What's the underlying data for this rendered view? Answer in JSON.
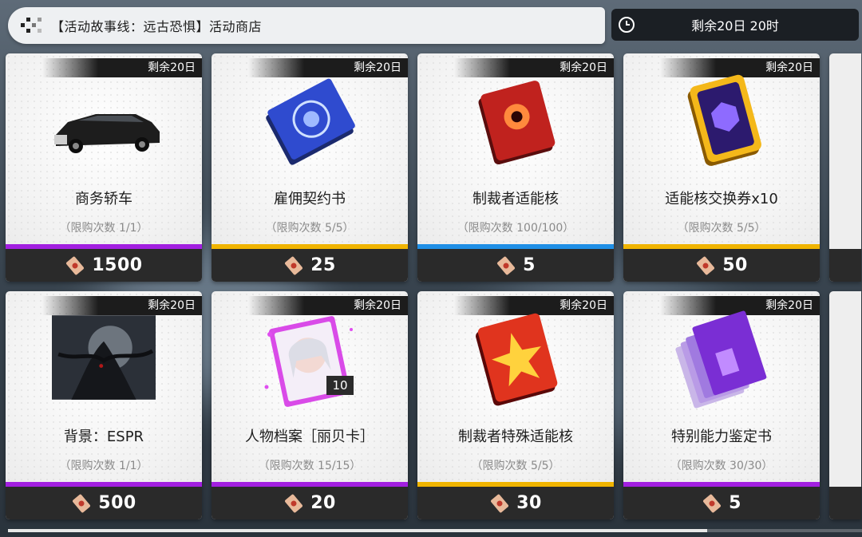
{
  "header": {
    "title": "【活动故事线：远古恐惧】活动商店",
    "timer": "剩余20日 20时"
  },
  "colors": {
    "purple": "#a21fe0",
    "gold": "#f0b400",
    "blue": "#1f8fe6"
  },
  "items": [
    {
      "remain": "剩余20日",
      "name": "商务轿车",
      "limit": "（限购次数 1/1）",
      "price": "1500",
      "rarity": "purple",
      "icon": "car-icon"
    },
    {
      "remain": "剩余20日",
      "name": "雇佣契约书",
      "limit": "（限购次数 5/5）",
      "price": "25",
      "rarity": "gold",
      "icon": "contract-book-icon"
    },
    {
      "remain": "剩余20日",
      "name": "制裁者适能核",
      "limit": "（限购次数 100/100）",
      "price": "5",
      "rarity": "blue",
      "icon": "red-core-icon"
    },
    {
      "remain": "剩余20日",
      "name": "适能核交换券x10",
      "limit": "（限购次数 5/5）",
      "price": "50",
      "rarity": "gold",
      "icon": "exchange-ticket-icon"
    },
    {
      "remain": "剩余20日",
      "name": "背景：ESPR",
      "limit": "（限购次数 1/1）",
      "price": "500",
      "rarity": "purple",
      "icon": "background-espr-icon"
    },
    {
      "remain": "剩余20日",
      "name": "人物档案［丽贝卡］",
      "limit": "（限购次数 15/15）",
      "price": "20",
      "rarity": "purple",
      "icon": "character-file-icon",
      "badge": "10"
    },
    {
      "remain": "剩余20日",
      "name": "制裁者特殊适能核",
      "limit": "（限购次数 5/5）",
      "price": "30",
      "rarity": "gold",
      "icon": "special-core-icon"
    },
    {
      "remain": "剩余20日",
      "name": "特别能力鉴定书",
      "limit": "（限购次数 30/30）",
      "price": "5",
      "rarity": "purple",
      "icon": "appraisal-book-icon"
    }
  ]
}
